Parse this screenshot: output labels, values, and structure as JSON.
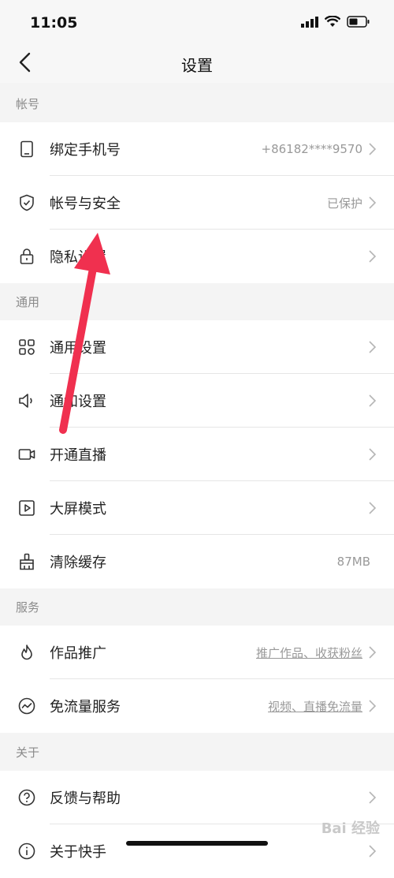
{
  "status": {
    "time": "11:05"
  },
  "header": {
    "title": "设置"
  },
  "sections": [
    {
      "label": "帐号",
      "rows": [
        {
          "icon": "phone-icon",
          "label": "绑定手机号",
          "value": "+86182****9570",
          "link": false,
          "chevron": true
        },
        {
          "icon": "shield-icon",
          "label": "帐号与安全",
          "value": "已保护",
          "link": false,
          "chevron": true
        },
        {
          "icon": "lock-icon",
          "label": "隐私设置",
          "value": "",
          "link": false,
          "chevron": true
        }
      ]
    },
    {
      "label": "通用",
      "rows": [
        {
          "icon": "grid-icon",
          "label": "通用设置",
          "value": "",
          "link": false,
          "chevron": true
        },
        {
          "icon": "speaker-icon",
          "label": "通知设置",
          "value": "",
          "link": false,
          "chevron": true
        },
        {
          "icon": "camera-icon",
          "label": "开通直播",
          "value": "",
          "link": false,
          "chevron": true
        },
        {
          "icon": "play-icon",
          "label": "大屏模式",
          "value": "",
          "link": false,
          "chevron": true
        },
        {
          "icon": "broom-icon",
          "label": "清除缓存",
          "value": "87MB",
          "link": false,
          "chevron": false
        }
      ]
    },
    {
      "label": "服务",
      "rows": [
        {
          "icon": "flame-icon",
          "label": "作品推广",
          "value": "推广作品、收获粉丝",
          "link": true,
          "chevron": true
        },
        {
          "icon": "wave-icon",
          "label": "免流量服务",
          "value": "视频、直播免流量",
          "link": true,
          "chevron": true
        }
      ]
    },
    {
      "label": "关于",
      "rows": [
        {
          "icon": "help-icon",
          "label": "反馈与帮助",
          "value": "",
          "link": false,
          "chevron": true
        },
        {
          "icon": "info-icon",
          "label": "关于快手",
          "value": "",
          "link": false,
          "chevron": true
        }
      ]
    }
  ],
  "watermark": "Bai 经验"
}
